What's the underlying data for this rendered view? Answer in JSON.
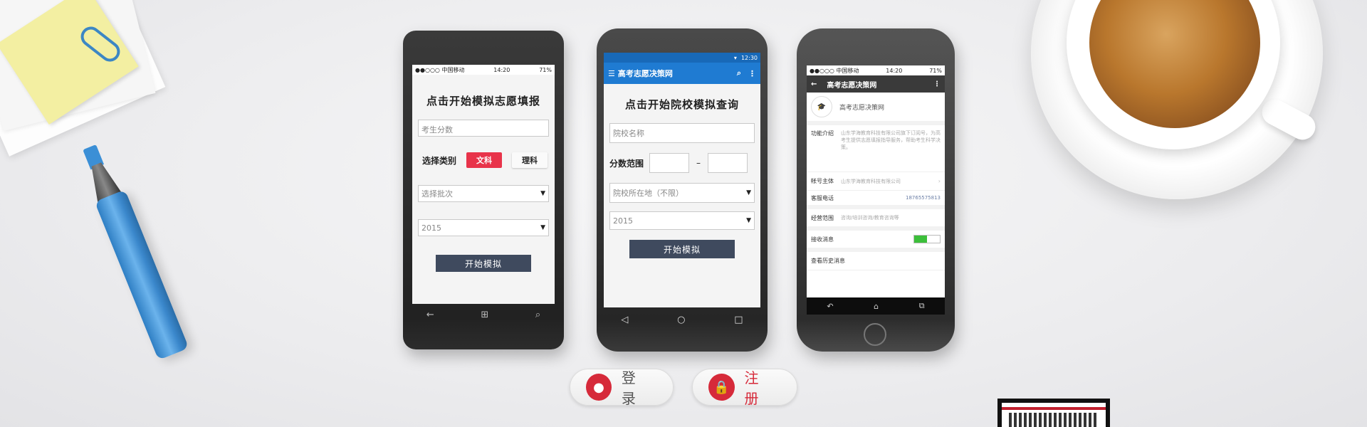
{
  "colors": {
    "accent_red": "#e8334a",
    "appbar_blue": "#1f7bd2",
    "start_button": "#3f4a5e",
    "toggle_green": "#3cbf3a"
  },
  "phone1": {
    "status": {
      "carrier": "●●○○○ 中国移动",
      "time": "14:20",
      "battery": "71%"
    },
    "title": "点击开始模拟志愿填报",
    "score_placeholder": "考生分数",
    "type_label": "选择类别",
    "type_option_arts": "文科",
    "type_option_science": "理科",
    "batch_select": "选择批次",
    "year_select": "2015",
    "start_button": "开始模拟"
  },
  "phone2": {
    "status": {
      "time": "12:30"
    },
    "app_title": "高考志愿决策网",
    "title": "点击开始院校模拟查询",
    "school_placeholder": "院校名称",
    "score_range_label": "分数范围",
    "range_separator": "–",
    "location_select": "院校所在地（不限）",
    "year_select": "2015",
    "start_button": "开始模拟"
  },
  "phone3": {
    "status": {
      "carrier": "●●○○○ 中国移动",
      "time": "14:20",
      "battery": "71%"
    },
    "header_title": "高考志愿决策网",
    "account_name": "高考志愿决策网",
    "rows": [
      {
        "label": "功能介绍",
        "value": "山东学海教育科技有限公司旗下订阅号，为高考生提供志愿填报指导服务，帮助考生科学决策。"
      },
      {
        "label": "帐号主体",
        "value": "山东学海教育科技有限公司"
      },
      {
        "label": "客服电话",
        "value": "18765575813"
      },
      {
        "label": "经营范围",
        "value": "咨询/培训咨询/教育咨询等"
      },
      {
        "label": "接收消息",
        "value": ""
      },
      {
        "label": "查看历史消息",
        "value": ""
      }
    ]
  },
  "login_label": "登 录",
  "register_label": "注 册"
}
